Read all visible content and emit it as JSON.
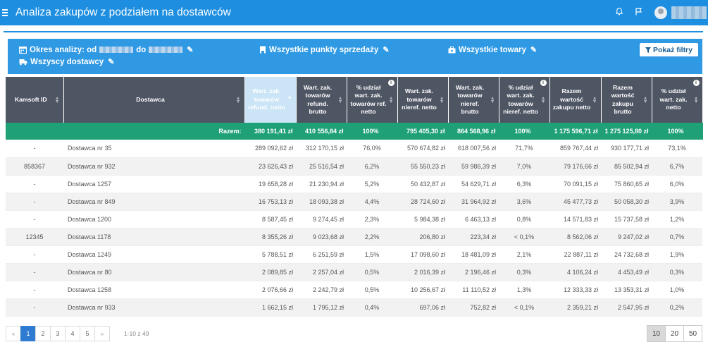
{
  "header": {
    "title": "Analiza zakupów z podziałem na dostawców"
  },
  "filters": {
    "period_prefix": "Okres analizy: od",
    "period_mid": "do",
    "points": "Wszystkie punkty sprzedaży",
    "goods": "Wszystkie towary",
    "suppliers": "Wszyscy dostawcy",
    "show_button": "Pokaż filtry"
  },
  "table": {
    "columns": [
      "Kamsoft ID",
      "Dostawca",
      "Wart. zak. towarów refund. netto",
      "Wart. zak. towarów refund. brutto",
      "% udział wart. zak. towarów ref. netto",
      "Wart. zak. towarów nieref. netto",
      "Wart. zak. towarów nieref. brutto",
      "% udział wart. zak. towarów nieref. netto",
      "Razem wartość zakupu netto",
      "Razem wartość zakupu brutto",
      "% udział wart. zak. netto"
    ],
    "total": {
      "label": "Razem:",
      "values": [
        "380 191,41 zł",
        "410 556,84 zł",
        "100%",
        "795 405,30 zł",
        "864 568,96 zł",
        "100%",
        "1 175 596,71 zł",
        "1 275 125,80 zł",
        "100%"
      ]
    },
    "rows": [
      [
        "-",
        "Dostawca nr 35",
        "289 092,62 zł",
        "312 170,15 zł",
        "76,0%",
        "570 674,82 zł",
        "618 007,56 zł",
        "71,7%",
        "859 767,44 zł",
        "930 177,71 zł",
        "73,1%"
      ],
      [
        "858367",
        "Dostawca nr 932",
        "23 626,43 zł",
        "25 516,54 zł",
        "6,2%",
        "55 550,23 zł",
        "59 986,39 zł",
        "7,0%",
        "79 176,66 zł",
        "85 502,94 zł",
        "6,7%"
      ],
      [
        "-",
        "Dostawca 1257",
        "19 658,28 zł",
        "21 230,94 zł",
        "5,2%",
        "50 432,87 zł",
        "54 629,71 zł",
        "6,3%",
        "70 091,15 zł",
        "75 860,65 zł",
        "6,0%"
      ],
      [
        "-",
        "Dostawca nr 849",
        "16 753,13 zł",
        "18 093,38 zł",
        "4,4%",
        "28 724,60 zł",
        "31 964,92 zł",
        "3,6%",
        "45 477,73 zł",
        "50 058,30 zł",
        "3,9%"
      ],
      [
        "-",
        "Dostawca 1200",
        "8 587,45 zł",
        "9 274,45 zł",
        "2,3%",
        "5 984,38 zł",
        "6 463,13 zł",
        "0,8%",
        "14 571,83 zł",
        "15 737,58 zł",
        "1,2%"
      ],
      [
        "12345",
        "Dostawca 1178",
        "8 355,26 zł",
        "9 023,68 zł",
        "2,2%",
        "206,80 zł",
        "223,34 zł",
        "< 0,1%",
        "8 562,06 zł",
        "9 247,02 zł",
        "0,7%"
      ],
      [
        "-",
        "Dostawca 1249",
        "5 788,51 zł",
        "6 251,59 zł",
        "1,5%",
        "17 098,60 zł",
        "18 481,09 zł",
        "2,1%",
        "22 887,11 zł",
        "24 732,68 zł",
        "1,9%"
      ],
      [
        "-",
        "Dostawca nr 80",
        "2 089,85 zł",
        "2 257,04 zł",
        "0,5%",
        "2 016,39 zł",
        "2 196,46 zł",
        "0,3%",
        "4 106,24 zł",
        "4 453,49 zł",
        "0,3%"
      ],
      [
        "-",
        "Dostawca 1258",
        "2 076,66 zł",
        "2 242,79 zł",
        "0,5%",
        "10 256,67 zł",
        "11 110,52 zł",
        "1,3%",
        "12 333,33 zł",
        "13 353,31 zł",
        "1,0%"
      ],
      [
        "-",
        "Dostawca nr 933",
        "1 662,15 zł",
        "1 795,12 zł",
        "0,4%",
        "697,06 zł",
        "752,82 zł",
        "< 0,1%",
        "2 359,21 zł",
        "2 547,95 zł",
        "0,2%"
      ]
    ]
  },
  "pagination": {
    "first": "«",
    "pages": [
      "1",
      "2",
      "3",
      "4",
      "5"
    ],
    "last": "»",
    "active_page": "1",
    "range": "1-10 z 49",
    "sizes": [
      "10",
      "20",
      "50"
    ],
    "active_size": "10"
  },
  "icons": {
    "menu": "hamburger-icon",
    "bell": "bell-icon",
    "flag": "flag-icon",
    "calendar": "calendar-icon",
    "store": "store-icon",
    "goods": "briefcase-icon",
    "truck": "truck-icon",
    "edit": "edit-icon",
    "filter": "filter-icon",
    "info": "info-icon"
  },
  "colors": {
    "primary": "#1d8ee0",
    "filter_bar": "#2f99e4",
    "table_header": "#4e5563",
    "total_row": "#1fa077",
    "active_page": "#2f7bd1"
  }
}
